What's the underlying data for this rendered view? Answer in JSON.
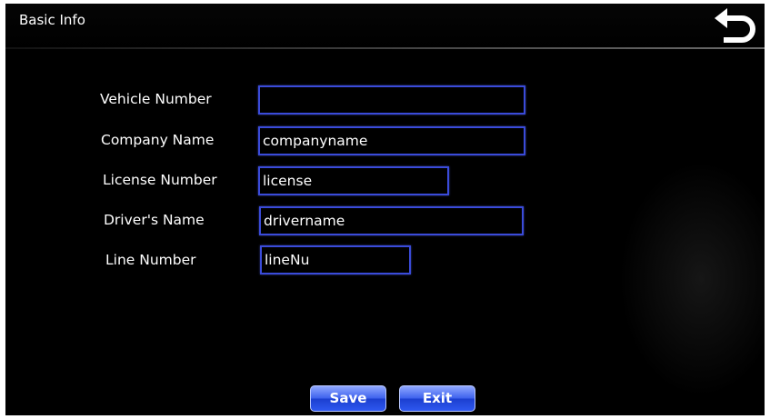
{
  "header": {
    "title": "Basic Info",
    "back_icon": "return-arrow-icon"
  },
  "form": {
    "fields": [
      {
        "label": "Vehicle Number",
        "value": ""
      },
      {
        "label": "Company Name",
        "value": "companyname"
      },
      {
        "label": "License Number",
        "value": "license"
      },
      {
        "label": "Driver's Name",
        "value": "drivername"
      },
      {
        "label": "Line Number",
        "value": "lineNu"
      }
    ]
  },
  "actions": {
    "save_label": "Save",
    "exit_label": "Exit"
  },
  "colors": {
    "background": "#000000",
    "field_border": "#3a4bd9",
    "button_blue": "#3f63ee",
    "text": "#ffffff"
  }
}
